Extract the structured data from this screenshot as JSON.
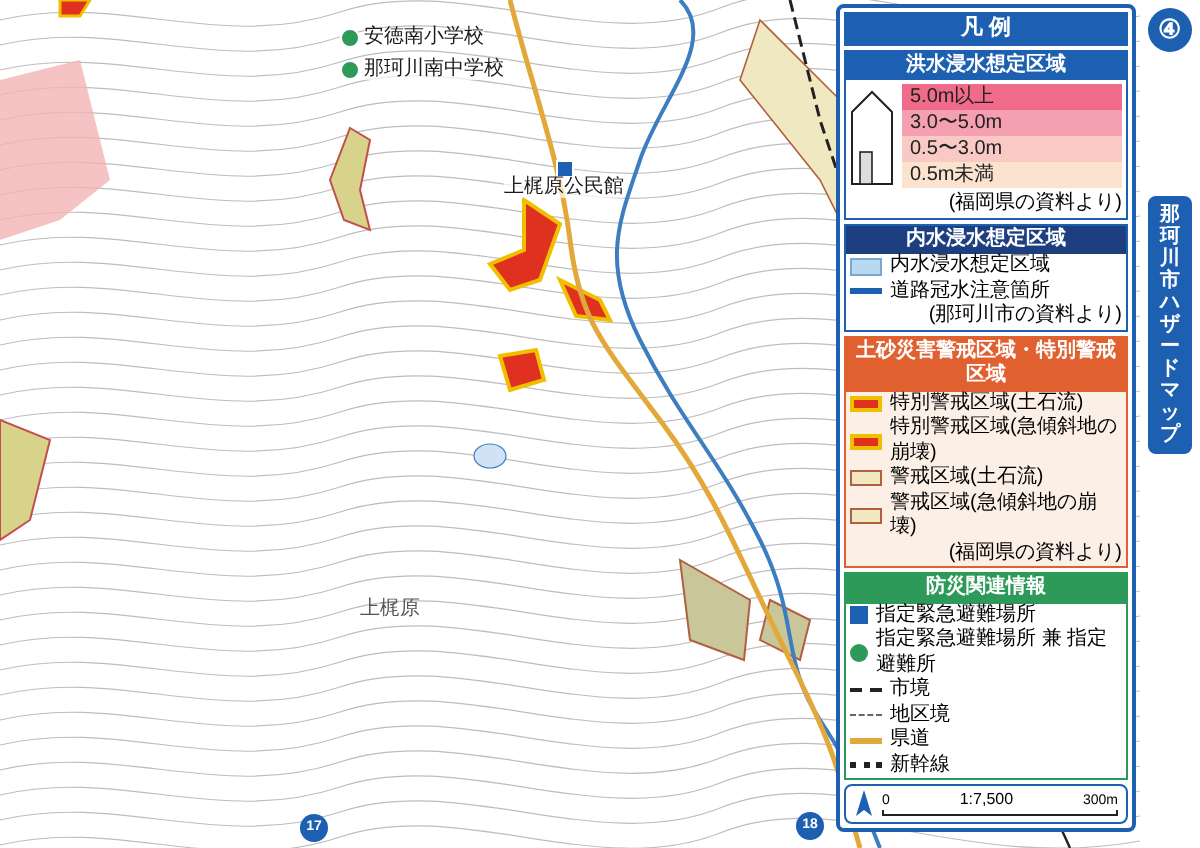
{
  "page_badge": "④",
  "map": {
    "labels": [
      {
        "kind": "school",
        "text": "安徳南小学校"
      },
      {
        "kind": "school",
        "text": "那珂川南中学校"
      },
      {
        "kind": "hall",
        "text": "上梶原公民館"
      },
      {
        "kind": "area",
        "text": "上梶原"
      },
      {
        "kind": "route",
        "text": "17"
      },
      {
        "kind": "route",
        "text": "18"
      }
    ]
  },
  "legend": {
    "title": "凡 例",
    "flood": {
      "heading": "洪水浸水想定区域",
      "depths": [
        {
          "label": "5.0m以上",
          "color": "#f06b8a"
        },
        {
          "label": "3.0〜5.0m",
          "color": "#f5a0b0"
        },
        {
          "label": "0.5〜3.0m",
          "color": "#f9c9c6"
        },
        {
          "label": "0.5m未満",
          "color": "#fbe3cf"
        }
      ],
      "source": "(福岡県の資料より)"
    },
    "inland": {
      "heading": "内水浸水想定区域",
      "items": [
        {
          "kind": "area",
          "label": "内水浸水想定区域"
        },
        {
          "kind": "line",
          "label": "道路冠水注意箇所"
        }
      ],
      "source": "(那珂川市の資料より)"
    },
    "landslide": {
      "heading": "土砂災害警戒区域・特別警戒区域",
      "items": [
        {
          "kind": "special",
          "label": "特別警戒区域(土石流)"
        },
        {
          "kind": "special",
          "label": "特別警戒区域(急傾斜地の崩壊)"
        },
        {
          "kind": "warning",
          "label": "警戒区域(土石流)"
        },
        {
          "kind": "warning",
          "label": "警戒区域(急傾斜地の崩壊)"
        }
      ],
      "source": "(福岡県の資料より)"
    },
    "disaster": {
      "heading": "防災関連情報",
      "items": [
        {
          "kind": "shelter",
          "label": "指定緊急避難場所"
        },
        {
          "kind": "shelter2",
          "label": "指定緊急避難場所 兼 指定避難所"
        },
        {
          "kind": "city",
          "label": "市境"
        },
        {
          "kind": "district",
          "label": "地区境"
        },
        {
          "kind": "road",
          "label": "県道"
        },
        {
          "kind": "rail",
          "label": "新幹線"
        }
      ]
    },
    "scale": {
      "ratio": "1:7,500",
      "start": "0",
      "end": "300m"
    }
  },
  "side_tab": "那珂川市ハザードマップ"
}
